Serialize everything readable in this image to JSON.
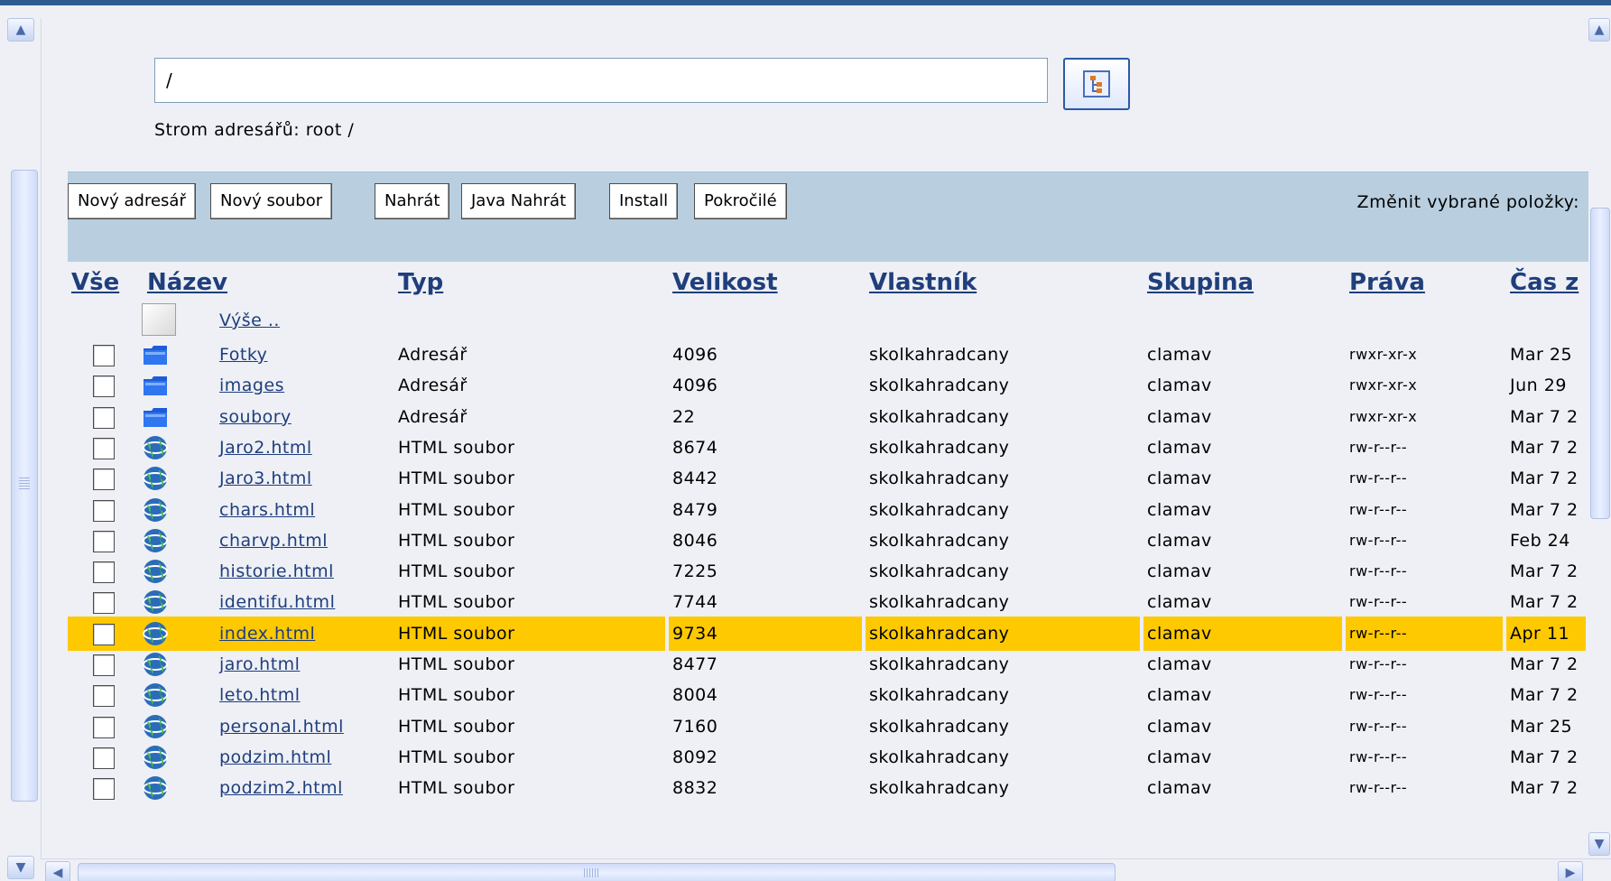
{
  "path_bar": {
    "value": "/",
    "tree_button_icon": "directory-tree-icon"
  },
  "dir_tree_label": "Strom adresářů: root /",
  "toolbar": {
    "buttons": [
      "Nový adresář",
      "Nový soubor",
      "Nahrát",
      "Java Nahrát",
      "Install",
      "Pokročilé"
    ],
    "change_selected_label": "Změnit vybrané položky:"
  },
  "table": {
    "headers": [
      "Vše",
      "Název",
      "Typ",
      "Velikost",
      "Vlastník",
      "Skupina",
      "Práva",
      "Čas z"
    ],
    "up_link": "Výše ..",
    "highlight_color": "#fec900",
    "rows": [
      {
        "name": "Fotky",
        "type": "Adresář",
        "size": "4096",
        "owner": "skolkahradcany",
        "group": "clamav",
        "perms": "rwxr-xr-x",
        "time": "Mar 25",
        "icon": "folder-icon"
      },
      {
        "name": "images",
        "type": "Adresář",
        "size": "4096",
        "owner": "skolkahradcany",
        "group": "clamav",
        "perms": "rwxr-xr-x",
        "time": "Jun 29",
        "icon": "folder-icon"
      },
      {
        "name": "soubory",
        "type": "Adresář",
        "size": "22",
        "owner": "skolkahradcany",
        "group": "clamav",
        "perms": "rwxr-xr-x",
        "time": "Mar 7 2",
        "icon": "folder-icon"
      },
      {
        "name": "Jaro2.html",
        "type": "HTML soubor",
        "size": "8674",
        "owner": "skolkahradcany",
        "group": "clamav",
        "perms": "rw-r--r--",
        "time": "Mar 7 2",
        "icon": "globe-icon"
      },
      {
        "name": "Jaro3.html",
        "type": "HTML soubor",
        "size": "8442",
        "owner": "skolkahradcany",
        "group": "clamav",
        "perms": "rw-r--r--",
        "time": "Mar 7 2",
        "icon": "globe-icon"
      },
      {
        "name": "chars.html",
        "type": "HTML soubor",
        "size": "8479",
        "owner": "skolkahradcany",
        "group": "clamav",
        "perms": "rw-r--r--",
        "time": "Mar 7 2",
        "icon": "globe-icon"
      },
      {
        "name": "charvp.html",
        "type": "HTML soubor",
        "size": "8046",
        "owner": "skolkahradcany",
        "group": "clamav",
        "perms": "rw-r--r--",
        "time": "Feb 24",
        "icon": "globe-icon"
      },
      {
        "name": "historie.html",
        "type": "HTML soubor",
        "size": "7225",
        "owner": "skolkahradcany",
        "group": "clamav",
        "perms": "rw-r--r--",
        "time": "Mar 7 2",
        "icon": "globe-icon"
      },
      {
        "name": "identifu.html",
        "type": "HTML soubor",
        "size": "7744",
        "owner": "skolkahradcany",
        "group": "clamav",
        "perms": "rw-r--r--",
        "time": "Mar 7 2",
        "icon": "globe-icon"
      },
      {
        "name": "index.html",
        "type": "HTML soubor",
        "size": "9734",
        "owner": "skolkahradcany",
        "group": "clamav",
        "perms": "rw-r--r--",
        "time": "Apr 11",
        "icon": "globe-icon",
        "highlighted": true
      },
      {
        "name": "jaro.html",
        "type": "HTML soubor",
        "size": "8477",
        "owner": "skolkahradcany",
        "group": "clamav",
        "perms": "rw-r--r--",
        "time": "Mar 7 2",
        "icon": "globe-icon"
      },
      {
        "name": "leto.html",
        "type": "HTML soubor",
        "size": "8004",
        "owner": "skolkahradcany",
        "group": "clamav",
        "perms": "rw-r--r--",
        "time": "Mar 7 2",
        "icon": "globe-icon"
      },
      {
        "name": "personal.html",
        "type": "HTML soubor",
        "size": "7160",
        "owner": "skolkahradcany",
        "group": "clamav",
        "perms": "rw-r--r--",
        "time": "Mar 25",
        "icon": "globe-icon"
      },
      {
        "name": "podzim.html",
        "type": "HTML soubor",
        "size": "8092",
        "owner": "skolkahradcany",
        "group": "clamav",
        "perms": "rw-r--r--",
        "time": "Mar 7 2",
        "icon": "globe-icon"
      },
      {
        "name": "podzim2.html",
        "type": "HTML soubor",
        "size": "8832",
        "owner": "skolkahradcany",
        "group": "clamav",
        "perms": "rw-r--r--",
        "time": "Mar 7 2",
        "icon": "globe-icon"
      }
    ]
  }
}
